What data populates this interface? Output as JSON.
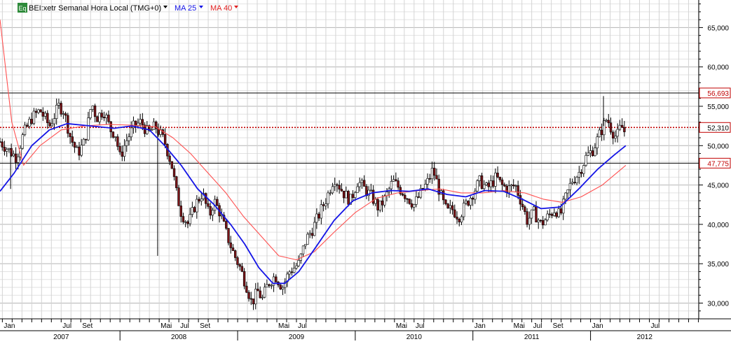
{
  "header": {
    "badge": "Eq",
    "instrument": "BEI:xetr Semanal Hora Local (TMG+0)",
    "ma_short": "MA 25",
    "ma_long": "MA 40"
  },
  "colors": {
    "up_candle": "#ffffff",
    "down_candle": "#7a1418",
    "ma_short": "#1414e6",
    "ma_long": "#ff5050",
    "resistance": "#000000",
    "last_price": "#c00000",
    "grid": "#c8c8c8",
    "badge": "#2e8b3a"
  },
  "chart_data": {
    "type": "candlestick",
    "y_ticks": [
      "65,000",
      "60,000",
      "55,000",
      "50,000",
      "45,000",
      "40,000",
      "35,000",
      "30,000"
    ],
    "ylim": [
      28000,
      68500
    ],
    "month_labels": [
      {
        "label": "Jan",
        "year": 2007,
        "month": 1
      },
      {
        "label": "Jul",
        "year": 2007,
        "month": 7
      },
      {
        "label": "Set",
        "year": 2007,
        "month": 9
      },
      {
        "label": "Mai",
        "year": 2008,
        "month": 5
      },
      {
        "label": "Jul",
        "year": 2008,
        "month": 7
      },
      {
        "label": "Set",
        "year": 2008,
        "month": 9
      },
      {
        "label": "Mai",
        "year": 2009,
        "month": 5
      },
      {
        "label": "Jul",
        "year": 2009,
        "month": 7
      },
      {
        "label": "Mai",
        "year": 2010,
        "month": 5
      },
      {
        "label": "Jul",
        "year": 2010,
        "month": 7
      },
      {
        "label": "Jan",
        "year": 2011,
        "month": 1
      },
      {
        "label": "Mai",
        "year": 2011,
        "month": 5
      },
      {
        "label": "Jul",
        "year": 2011,
        "month": 7
      },
      {
        "label": "Set",
        "year": 2011,
        "month": 9
      },
      {
        "label": "Jan",
        "year": 2012,
        "month": 1
      },
      {
        "label": "Jul",
        "year": 2012,
        "month": 7
      }
    ],
    "year_labels": [
      {
        "label": "2007",
        "year": 2007
      },
      {
        "label": "2008",
        "year": 2008
      },
      {
        "label": "2009",
        "year": 2009
      },
      {
        "label": "2010",
        "year": 2010
      },
      {
        "label": "2011",
        "year": 2011
      },
      {
        "label": "2012",
        "year": 2012
      }
    ],
    "reference_lines": [
      {
        "value": 56693,
        "label": "56,693",
        "style": "solid"
      },
      {
        "value": 52310,
        "label": "52,310",
        "style": "dotted"
      },
      {
        "value": 47775,
        "label": "47,775",
        "style": "solid"
      }
    ],
    "price_path": [
      [
        2006.98,
        50500
      ],
      [
        2007.05,
        49500
      ],
      [
        2007.12,
        48500
      ],
      [
        2007.18,
        51500
      ],
      [
        2007.25,
        53500
      ],
      [
        2007.32,
        54500
      ],
      [
        2007.4,
        52500
      ],
      [
        2007.48,
        55000
      ],
      [
        2007.52,
        54500
      ],
      [
        2007.58,
        51000
      ],
      [
        2007.64,
        49000
      ],
      [
        2007.7,
        50500
      ],
      [
        2007.76,
        55500
      ],
      [
        2007.8,
        53500
      ],
      [
        2007.86,
        54500
      ],
      [
        2007.92,
        52000
      ],
      [
        2007.96,
        51500
      ],
      [
        2008.0,
        48500
      ],
      [
        2008.05,
        50500
      ],
      [
        2008.12,
        52500
      ],
      [
        2008.18,
        53000
      ],
      [
        2008.24,
        51500
      ],
      [
        2008.3,
        52500
      ],
      [
        2008.38,
        50500
      ],
      [
        2008.44,
        47500
      ],
      [
        2008.48,
        44000
      ],
      [
        2008.52,
        41500
      ],
      [
        2008.58,
        40000
      ],
      [
        2008.64,
        42500
      ],
      [
        2008.7,
        44000
      ],
      [
        2008.76,
        41000
      ],
      [
        2008.8,
        43000
      ],
      [
        2008.85,
        41500
      ],
      [
        2008.9,
        39000
      ],
      [
        2008.96,
        36500
      ],
      [
        2009.02,
        34500
      ],
      [
        2009.08,
        32000
      ],
      [
        2009.12,
        30000
      ],
      [
        2009.17,
        31500
      ],
      [
        2009.21,
        30500
      ],
      [
        2009.26,
        32500
      ],
      [
        2009.32,
        33500
      ],
      [
        2009.38,
        32000
      ],
      [
        2009.44,
        34000
      ],
      [
        2009.52,
        35000
      ],
      [
        2009.58,
        38000
      ],
      [
        2009.64,
        39500
      ],
      [
        2009.7,
        41500
      ],
      [
        2009.76,
        43500
      ],
      [
        2009.82,
        46000
      ],
      [
        2009.86,
        45000
      ],
      [
        2009.9,
        44000
      ],
      [
        2009.96,
        43000
      ],
      [
        2010.02,
        45500
      ],
      [
        2010.08,
        44500
      ],
      [
        2010.14,
        43500
      ],
      [
        2010.2,
        42000
      ],
      [
        2010.26,
        43500
      ],
      [
        2010.32,
        45500
      ],
      [
        2010.38,
        44500
      ],
      [
        2010.44,
        43500
      ],
      [
        2010.5,
        42500
      ],
      [
        2010.56,
        44000
      ],
      [
        2010.62,
        45500
      ],
      [
        2010.66,
        47000
      ],
      [
        2010.7,
        45000
      ],
      [
        2010.74,
        43000
      ],
      [
        2010.78,
        41500
      ],
      [
        2010.82,
        42000
      ],
      [
        2010.88,
        41000
      ],
      [
        2010.94,
        42500
      ],
      [
        2011.0,
        44000
      ],
      [
        2011.06,
        45500
      ],
      [
        2011.12,
        44500
      ],
      [
        2011.2,
        46000
      ],
      [
        2011.24,
        45000
      ],
      [
        2011.3,
        44500
      ],
      [
        2011.36,
        45000
      ],
      [
        2011.42,
        42500
      ],
      [
        2011.46,
        40500
      ],
      [
        2011.52,
        41500
      ],
      [
        2011.58,
        40000
      ],
      [
        2011.64,
        41000
      ],
      [
        2011.7,
        42000
      ],
      [
        2011.74,
        41000
      ],
      [
        2011.78,
        43000
      ],
      [
        2011.84,
        45500
      ],
      [
        2011.9,
        46500
      ],
      [
        2011.96,
        48500
      ],
      [
        2012.02,
        49500
      ],
      [
        2012.08,
        51500
      ],
      [
        2012.14,
        53500
      ],
      [
        2012.18,
        52000
      ],
      [
        2012.22,
        51000
      ],
      [
        2012.26,
        52500
      ],
      [
        2012.3,
        51500
      ]
    ],
    "ma25_path": [
      [
        2006.98,
        44200
      ],
      [
        2007.1,
        46500
      ],
      [
        2007.25,
        50000
      ],
      [
        2007.4,
        52000
      ],
      [
        2007.55,
        52800
      ],
      [
        2007.75,
        52500
      ],
      [
        2007.95,
        52200
      ],
      [
        2008.1,
        52500
      ],
      [
        2008.25,
        52000
      ],
      [
        2008.38,
        50000
      ],
      [
        2008.52,
        47500
      ],
      [
        2008.66,
        44500
      ],
      [
        2008.8,
        42500
      ],
      [
        2008.94,
        40000
      ],
      [
        2009.06,
        37500
      ],
      [
        2009.18,
        34500
      ],
      [
        2009.3,
        32500
      ],
      [
        2009.4,
        32500
      ],
      [
        2009.52,
        34000
      ],
      [
        2009.66,
        37000
      ],
      [
        2009.82,
        40500
      ],
      [
        2009.98,
        43000
      ],
      [
        2010.14,
        44000
      ],
      [
        2010.3,
        44300
      ],
      [
        2010.46,
        44200
      ],
      [
        2010.62,
        44500
      ],
      [
        2010.78,
        43800
      ],
      [
        2010.94,
        43500
      ],
      [
        2011.1,
        44300
      ],
      [
        2011.26,
        44200
      ],
      [
        2011.42,
        43200
      ],
      [
        2011.58,
        42000
      ],
      [
        2011.74,
        42200
      ],
      [
        2011.9,
        44500
      ],
      [
        2012.06,
        47000
      ],
      [
        2012.2,
        48800
      ],
      [
        2012.3,
        50000
      ]
    ],
    "ma40_path": [
      [
        2006.98,
        66000
      ],
      [
        2007.08,
        53000
      ],
      [
        2007.18,
        47500
      ],
      [
        2007.32,
        50000
      ],
      [
        2007.5,
        52000
      ],
      [
        2007.7,
        52500
      ],
      [
        2007.9,
        52700
      ],
      [
        2008.1,
        52600
      ],
      [
        2008.3,
        52400
      ],
      [
        2008.45,
        51000
      ],
      [
        2008.6,
        49000
      ],
      [
        2008.75,
        46500
      ],
      [
        2008.9,
        44000
      ],
      [
        2009.05,
        41000
      ],
      [
        2009.2,
        38500
      ],
      [
        2009.35,
        36000
      ],
      [
        2009.5,
        35500
      ],
      [
        2009.65,
        36500
      ],
      [
        2009.82,
        39000
      ],
      [
        2010.0,
        41500
      ],
      [
        2010.18,
        43300
      ],
      [
        2010.36,
        44000
      ],
      [
        2010.55,
        44300
      ],
      [
        2010.72,
        44500
      ],
      [
        2010.9,
        44000
      ],
      [
        2011.08,
        44000
      ],
      [
        2011.26,
        44300
      ],
      [
        2011.44,
        44000
      ],
      [
        2011.6,
        43200
      ],
      [
        2011.76,
        42800
      ],
      [
        2011.92,
        43500
      ],
      [
        2012.1,
        45000
      ],
      [
        2012.22,
        46500
      ],
      [
        2012.3,
        47500
      ]
    ],
    "outliers": [
      {
        "year": 2007.07,
        "low": 44500
      },
      {
        "year": 2008.32,
        "low": 36000
      },
      {
        "year": 2012.11,
        "high": 56300
      }
    ]
  }
}
